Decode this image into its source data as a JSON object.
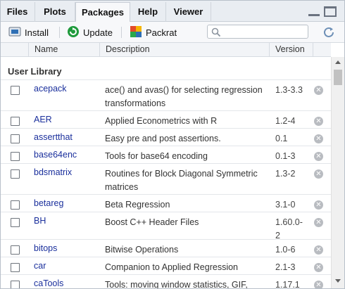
{
  "tabs": [
    {
      "label": "Files",
      "active": false
    },
    {
      "label": "Plots",
      "active": false
    },
    {
      "label": "Packages",
      "active": true
    },
    {
      "label": "Help",
      "active": false
    },
    {
      "label": "Viewer",
      "active": false
    }
  ],
  "toolbar": {
    "install_label": "Install",
    "update_label": "Update",
    "packrat_label": "Packrat",
    "search_placeholder": ""
  },
  "columns": {
    "name": "Name",
    "description": "Description",
    "version": "Version"
  },
  "group_label": "User Library",
  "packages": [
    {
      "name": "acepack",
      "description": "ace() and avas() for selecting regression transformations",
      "version": "1.3-3.3"
    },
    {
      "name": "AER",
      "description": "Applied Econometrics with R",
      "version": "1.2-4"
    },
    {
      "name": "assertthat",
      "description": "Easy pre and post assertions.",
      "version": "0.1"
    },
    {
      "name": "base64enc",
      "description": "Tools for base64 encoding",
      "version": "0.1-3"
    },
    {
      "name": "bdsmatrix",
      "description": "Routines for Block Diagonal Symmetric matrices",
      "version": "1.3-2"
    },
    {
      "name": "betareg",
      "description": "Beta Regression",
      "version": "3.1-0"
    },
    {
      "name": "BH",
      "description": "Boost C++ Header Files",
      "version": "1.60.0-2"
    },
    {
      "name": "bitops",
      "description": "Bitwise Operations",
      "version": "1.0-6"
    },
    {
      "name": "car",
      "description": "Companion to Applied Regression",
      "version": "2.1-3"
    },
    {
      "name": "caTools",
      "description": "Tools: moving window statistics, GIF,",
      "version": "1.17.1"
    }
  ],
  "colors": {
    "package_link": "#1a2f9c",
    "update_icon": "#1f9a3c",
    "install_icon": "#2f6fb5"
  }
}
